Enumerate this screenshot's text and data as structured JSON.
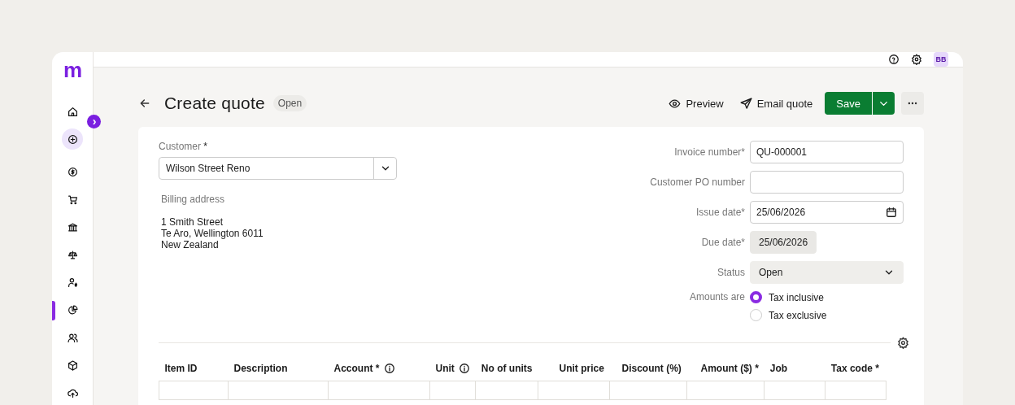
{
  "app": {
    "logo": "m",
    "expand_button": "›"
  },
  "sidebar": {
    "items": [
      {
        "kind": "home",
        "selected": false,
        "highlighted": false
      },
      {
        "kind": "create",
        "selected": false,
        "highlighted": true
      },
      {
        "kind": "dollar",
        "selected": false,
        "highlighted": false
      },
      {
        "kind": "cart",
        "selected": false,
        "highlighted": false
      },
      {
        "kind": "bank",
        "selected": false,
        "highlighted": false
      },
      {
        "kind": "scales",
        "selected": false,
        "highlighted": false
      },
      {
        "kind": "person-dollar",
        "selected": false,
        "highlighted": false
      },
      {
        "kind": "pie",
        "selected": true,
        "highlighted": false
      },
      {
        "kind": "people",
        "selected": false,
        "highlighted": false
      },
      {
        "kind": "box",
        "selected": false,
        "highlighted": false
      },
      {
        "kind": "cloud",
        "selected": false,
        "highlighted": false
      }
    ]
  },
  "topbar": {
    "avatar": "BB"
  },
  "page": {
    "title": "Create quote",
    "status_badge": "Open",
    "actions": [
      {
        "kind": "preview",
        "label": "Preview"
      },
      {
        "kind": "email",
        "label": "Email quote"
      },
      {
        "kind": "save",
        "label": "Save"
      }
    ]
  },
  "customer": {
    "label": "Customer",
    "required_mark": "*",
    "value": "Wilson Street Reno"
  },
  "billing": {
    "label": "Billing address",
    "lines": [
      "1 Smith Street",
      "Te Aro, Wellington 6011",
      "New Zealand"
    ]
  },
  "fields": [
    {
      "kind": "text",
      "label": "Invoice number*",
      "value": "QU-000001"
    },
    {
      "kind": "text",
      "label": "Customer PO number"
    },
    {
      "kind": "date",
      "label": "Issue date*",
      "value": "25/06/2026"
    },
    {
      "kind": "readonly",
      "label": "Due date*",
      "value": "25/06/2026"
    },
    {
      "kind": "select",
      "label": "Status",
      "value": "Open"
    }
  ],
  "amounts": {
    "label": "Amounts are",
    "options": [
      {
        "label": "Tax inclusive",
        "selected": true
      },
      {
        "label": "Tax exclusive",
        "selected": false
      }
    ]
  },
  "table": {
    "columns": [
      {
        "label": "Item ID",
        "info": false,
        "numeric": false
      },
      {
        "label": "Description",
        "info": false,
        "numeric": false
      },
      {
        "label": "Account *",
        "info": true,
        "numeric": false
      },
      {
        "label": "Unit",
        "info": true,
        "numeric": false
      },
      {
        "label": "No of units",
        "info": false,
        "numeric": false
      },
      {
        "label": "Unit price",
        "info": false,
        "numeric": true
      },
      {
        "label": "Discount (%)",
        "info": false,
        "numeric": true
      },
      {
        "label": "Amount ($) *",
        "info": false,
        "numeric": true
      },
      {
        "label": "Job",
        "info": false,
        "numeric": false
      },
      {
        "label": "Tax code *",
        "info": false,
        "numeric": false
      }
    ]
  }
}
